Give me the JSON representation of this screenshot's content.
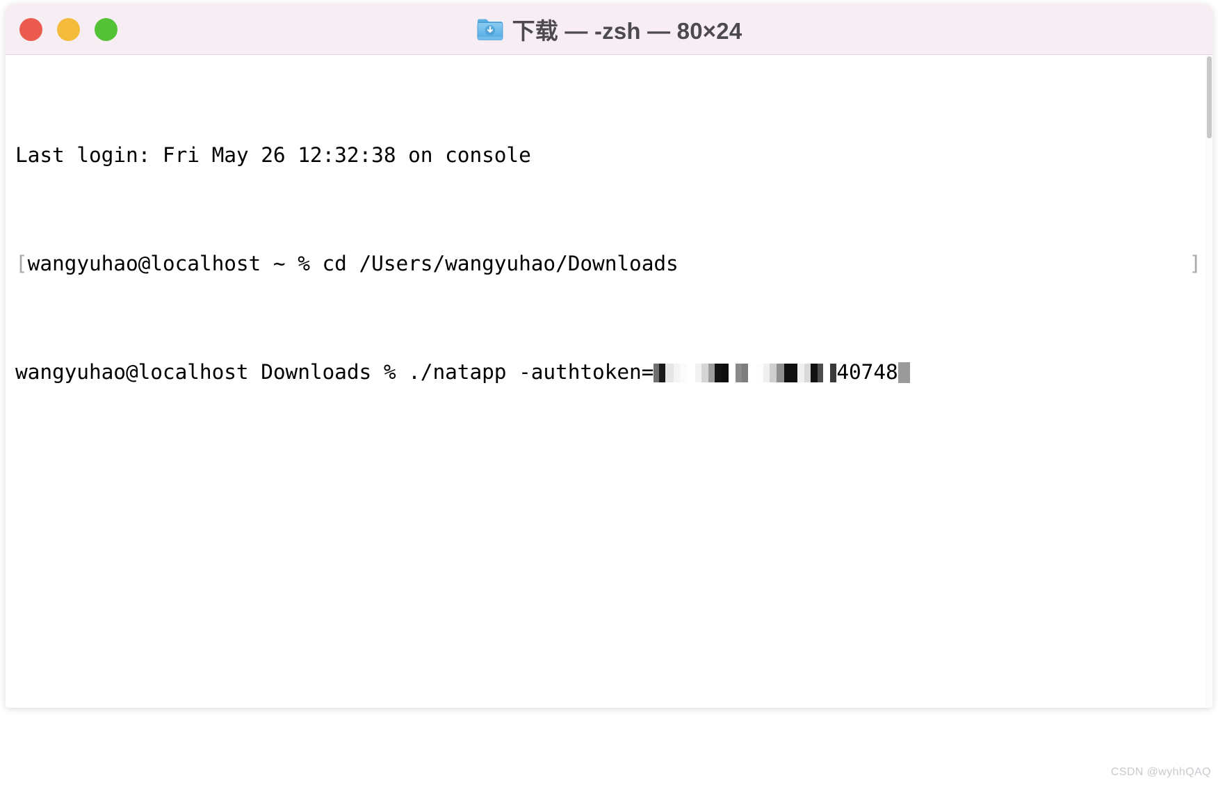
{
  "window": {
    "title": "下载 — -zsh — 80×24",
    "app": "Terminal",
    "icon_name": "downloads-folder-icon",
    "traffic_lights": {
      "close_label": "Close",
      "minimize_label": "Minimize",
      "zoom_label": "Zoom",
      "close_color": "#ea5a4f",
      "minimize_color": "#f5bc3c",
      "zoom_color": "#53c236"
    },
    "titlebar_color": "#f7eef4",
    "body_color": "#ffffff",
    "text_color": "#000000"
  },
  "terminal": {
    "columns": 80,
    "rows": 24,
    "lines": {
      "line1": "Last login: Fri May 26 12:32:38 on console",
      "line2_bracket_open": "[",
      "line2": "wangyuhao@localhost ~ % cd /Users/wangyuhao/Downloads",
      "line2_bracket_close": "]",
      "line3_prompt": "wangyuhao@localhost Downloads % ./natapp -authtoken=",
      "line3_token_visible_suffix": "40748",
      "line3_token_masked": "[redacted]"
    }
  },
  "watermark": {
    "text": "CSDN @wyhhQAQ"
  }
}
